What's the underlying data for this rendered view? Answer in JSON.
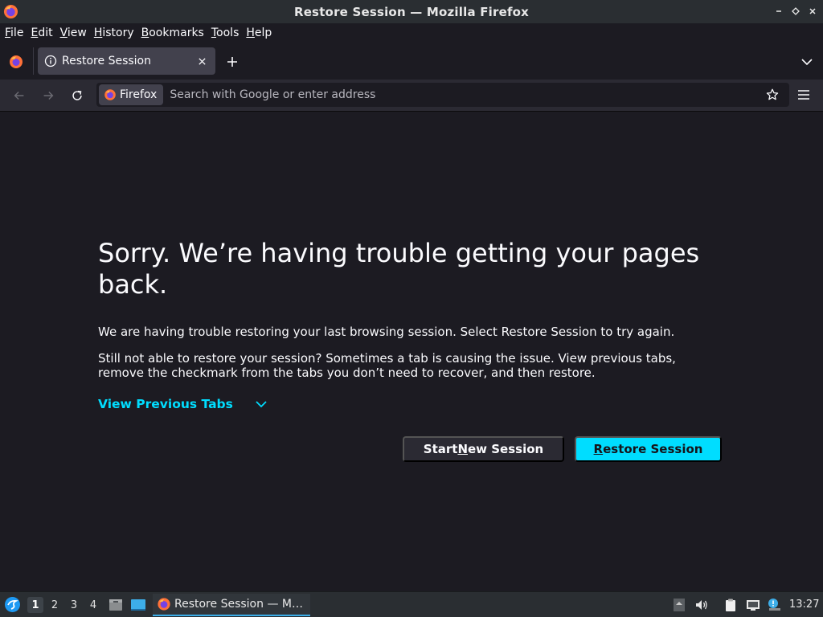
{
  "window": {
    "title": "Restore Session — Mozilla Firefox"
  },
  "menubar": {
    "items": [
      {
        "underline": "F",
        "rest": "ile"
      },
      {
        "underline": "E",
        "rest": "dit"
      },
      {
        "underline": "V",
        "rest": "iew"
      },
      {
        "underline": "H",
        "rest": "istory"
      },
      {
        "underline": "B",
        "rest": "ookmarks"
      },
      {
        "underline": "T",
        "rest": "ools"
      },
      {
        "underline": "H",
        "rest": "elp"
      }
    ]
  },
  "tabs": [
    {
      "label": "Restore Session",
      "active": true
    }
  ],
  "navbar": {
    "identity_label": "Firefox",
    "url_placeholder": "Search with Google or enter address",
    "url_value": ""
  },
  "page": {
    "heading": "Sorry. We’re having trouble getting your pages back.",
    "para1": "We are having trouble restoring your last browsing session. Select Restore Session to try again.",
    "para2": "Still not able to restore your session? Sometimes a tab is causing the issue. View previous tabs, remove the checkmark from the tabs you don’t need to recover, and then restore.",
    "view_previous_tabs": "View Previous Tabs",
    "start_new_session": {
      "before": "Start ",
      "underline": "N",
      "after": "ew Session"
    },
    "restore_session": {
      "before": "",
      "underline": "R",
      "after": "estore Session"
    }
  },
  "taskbar": {
    "desktops": [
      "1",
      "2",
      "3",
      "4"
    ],
    "active_desktop": "1",
    "window_label": "Restore Session — M…",
    "clock": "13:27"
  },
  "colors": {
    "accent": "#00ddff",
    "page_bg": "#1c1b22",
    "toolbar_bg": "#2b2a33",
    "tab_bg": "#42414d",
    "panel_bg": "#2a2e32"
  },
  "icons": {
    "app": "firefox-icon",
    "tab": "info-icon",
    "close": "close-icon",
    "new_tab": "plus-icon",
    "tab_list": "chevron-down-icon",
    "back": "back-arrow-icon",
    "forward": "forward-arrow-icon",
    "reload": "reload-icon",
    "bookmark": "star-icon",
    "menu": "hamburger-icon"
  }
}
